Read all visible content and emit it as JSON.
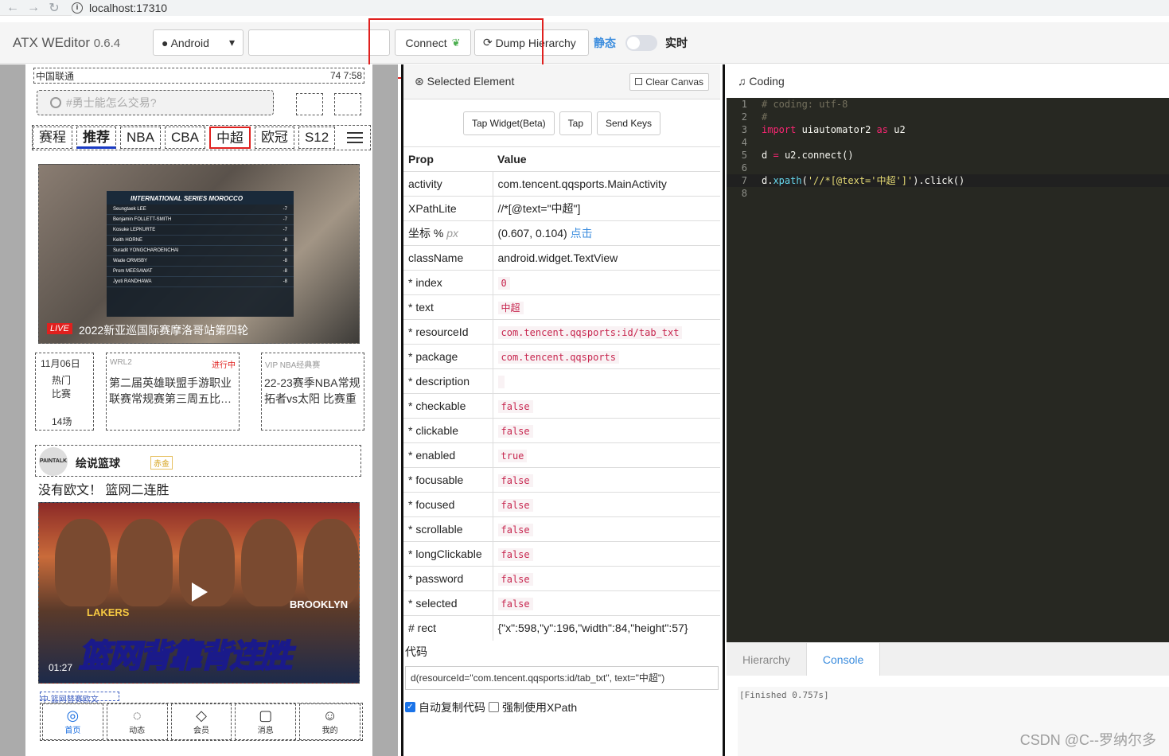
{
  "browser": {
    "url": "localhost:17310"
  },
  "toolbar": {
    "brand_name": "ATX WEditor",
    "brand_version": "0.6.4",
    "platform": "Android",
    "connect_label": "Connect",
    "dump_label": "Dump Hierarchy",
    "mode_static": "静态",
    "mode_live": "实时"
  },
  "phone": {
    "carrier": "中国联通",
    "battery": "74",
    "time": "7:58",
    "search_placeholder": "#勇士能怎么交易?",
    "tabs": [
      "赛程",
      "推荐",
      "NBA",
      "CBA",
      "中超",
      "欧冠",
      "S12"
    ],
    "hero": {
      "live": "LIVE",
      "title": "2022新亚巡国际赛摩洛哥站第四轮",
      "board_title": "INTERNATIONAL SERIES MOROCCO",
      "board_rows": [
        {
          "name": "Seungtaek LEE",
          "score": "-7"
        },
        {
          "name": "Benjamin FOLLETT-SMITH",
          "score": "-7"
        },
        {
          "name": "Kosuke LEPKURTE",
          "score": "-7"
        },
        {
          "name": "Keith HORNE",
          "score": "-8"
        },
        {
          "name": "Suradit YONGCHAROENCHAI",
          "score": "-8"
        },
        {
          "name": "Wade ORMSBY",
          "score": "-8"
        },
        {
          "name": "Prom MEESAWAT",
          "score": "-8"
        },
        {
          "name": "Jyoti RANDHAWA",
          "score": "-8"
        }
      ]
    },
    "match1": {
      "date": "11月06日",
      "hot": "热门比赛",
      "count": "14场"
    },
    "match2": {
      "league": "WRL2",
      "status": "进行中",
      "title": "第二届英雄联盟手游职业联赛常规赛第三周五比…"
    },
    "match3": {
      "vip": "VIP",
      "league": "NBA经典赛",
      "title": "22-23赛季NBA常规拓者vs太阳 比赛重"
    },
    "post": {
      "avatar": "PAINTALK",
      "author": "绘说篮球",
      "badge": "赤金",
      "title": "没有欧文！ 篮网二连胜",
      "slogan": "篮网背靠背连胜",
      "duration": "01:27",
      "team1": "LAKERS",
      "team2": "BROOKLYN"
    },
    "scroll_hint": "中 篮网替赛欧文",
    "nav": [
      "首页",
      "动态",
      "会员",
      "消息",
      "我的"
    ]
  },
  "selected": {
    "title": "Selected Element",
    "clear_label": "Clear Canvas",
    "actions": [
      "Tap Widget(Beta)",
      "Tap",
      "Send Keys"
    ],
    "headers": {
      "prop": "Prop",
      "value": "Value"
    },
    "props": {
      "activity": "com.tencent.qqsports.MainActivity",
      "xpathlite": "//*[@text=\"中超\"]",
      "coord": "(0.607, 0.104)",
      "coord_link": "点击",
      "classname": "android.widget.TextView",
      "index": "0",
      "text": "中超",
      "resourceid": "com.tencent.qqsports:id/tab_txt",
      "package": "com.tencent.qqsports",
      "description": "",
      "checkable": "false",
      "clickable": "false",
      "enabled": "true",
      "focusable": "false",
      "focused": "false",
      "scrollable": "false",
      "longclickable": "false",
      "password": "false",
      "selected": "false",
      "rect": "{\"x\":598,\"y\":196,\"width\":84,\"height\":57}"
    },
    "labels": {
      "activity": "activity",
      "xpathlite": "XPathLite",
      "coord": "坐标 %",
      "coord_unit": "px",
      "classname": "className",
      "index": "* index",
      "text": "* text",
      "resourceid": "* resourceId",
      "package": "* package",
      "description": "* description",
      "checkable": "* checkable",
      "clickable": "* clickable",
      "enabled": "* enabled",
      "focusable": "* focusable",
      "focused": "* focused",
      "scrollable": "* scrollable",
      "longclickable": "* longClickable",
      "password": "* password",
      "selected": "* selected",
      "rect": "# rect"
    },
    "code_label": "代码",
    "code_value": "d(resourceId=\"com.tencent.qqsports:id/tab_txt\", text=\"中超\")",
    "opt_copy": "自动复制代码",
    "opt_xpath": "强制使用XPath"
  },
  "coding": {
    "title": "Coding",
    "lines": {
      "l1": "# coding: utf-8",
      "l2": "#",
      "l3_kw": "import",
      "l3_mod": "uiautomator2",
      "l3_as": "as",
      "l3_alias": "u2",
      "l5_var": "d",
      "l5_call": "u2.connect()",
      "l7_obj": "d.",
      "l7_fn": "xpath",
      "l7_str": "'//*[@text='中超']'",
      "l7_end": ").click()"
    },
    "tab_hierarchy": "Hierarchy",
    "tab_console": "Console",
    "console_text": "[Finished 0.757s]"
  },
  "watermark": "CSDN @C--罗纳尔多"
}
